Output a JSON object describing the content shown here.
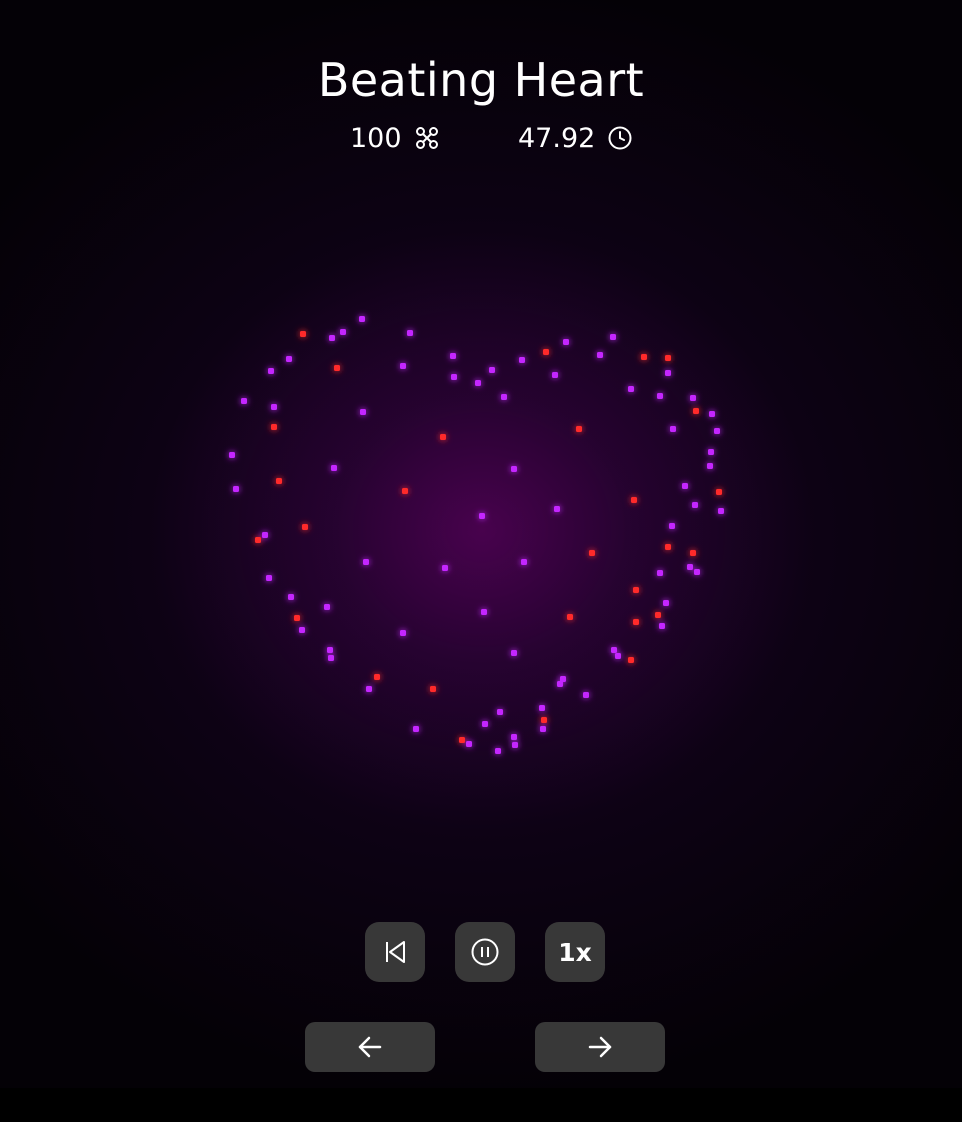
{
  "show": {
    "title": "Beating Heart",
    "drone_count": "100",
    "duration": "47.92"
  },
  "icons": {
    "drone": "drone-icon",
    "clock": "clock-icon",
    "restart": "skip-back-icon",
    "pause": "pause-circle-icon",
    "prev": "arrow-left-icon",
    "next": "arrow-right-icon"
  },
  "controls": {
    "speed_label": "1x"
  },
  "colors": {
    "drone_purple": "#c426ff",
    "drone_red": "#ff2a2a",
    "button_bg": "#383838"
  }
}
